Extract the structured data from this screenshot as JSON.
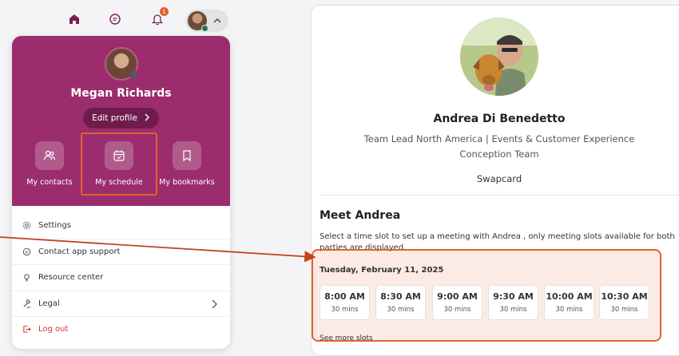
{
  "topnav": {
    "notification_count": "1",
    "icons": [
      "home-icon",
      "chat-icon",
      "bell-icon",
      "chevron-up-icon"
    ]
  },
  "dropdown": {
    "user_name": "Megan Richards",
    "edit_profile_label": "Edit profile",
    "quick_actions": [
      {
        "label": "My contacts",
        "icon": "contacts-icon"
      },
      {
        "label": "My schedule",
        "icon": "calendar-check-icon"
      },
      {
        "label": "My bookmarks",
        "icon": "bookmark-icon"
      }
    ],
    "menu": [
      {
        "label": "Settings",
        "icon": "gear-icon"
      },
      {
        "label": "Contact app support",
        "icon": "support-chat-icon"
      },
      {
        "label": "Resource center",
        "icon": "lightbulb-icon"
      },
      {
        "label": "Legal",
        "icon": "legal-icon"
      },
      {
        "label": "Log out",
        "icon": "logout-icon"
      }
    ],
    "brand_color": "#9b2d6e"
  },
  "profile": {
    "name": "Andrea Di Benedetto",
    "title_line1": "Team Lead North America | Events & Customer Experience",
    "title_line2": "Conception Team",
    "company": "Swapcard",
    "meet_title": "Meet Andrea",
    "meet_description": "Select a time slot to set up a meeting with Andrea , only meeting slots available for both parties are displayed.",
    "slots_date": "Tuesday, February 11, 2025",
    "slots": [
      {
        "time": "8:00 AM",
        "duration": "30 mins"
      },
      {
        "time": "8:30 AM",
        "duration": "30 mins"
      },
      {
        "time": "9:00 AM",
        "duration": "30 mins"
      },
      {
        "time": "9:30 AM",
        "duration": "30 mins"
      },
      {
        "time": "10:00 AM",
        "duration": "30 mins"
      },
      {
        "time": "10:30 AM",
        "duration": "30 mins"
      }
    ],
    "see_more": "See more slots"
  },
  "highlight_color": "#e2622c"
}
